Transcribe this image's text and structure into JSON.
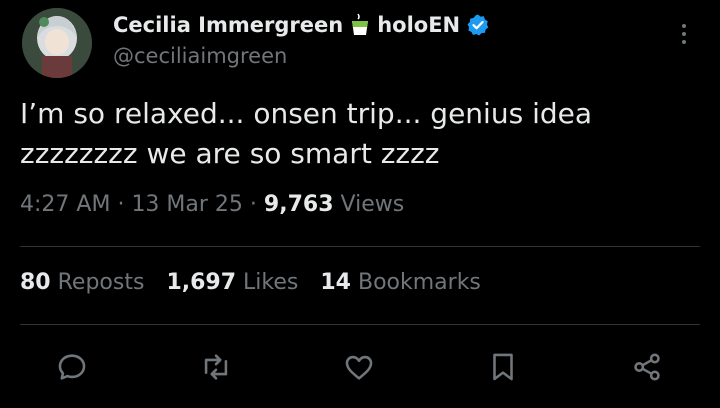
{
  "author": {
    "display_name": "Cecilia Immergreen",
    "affiliation": "holoEN",
    "handle": "@ceciliaimgreen",
    "emoji_icon": "tea-cup-icon",
    "verified_icon": "verified-badge-icon",
    "verified_color": "#1d9bf0"
  },
  "tweet": {
    "text": "I’m so relaxed... onsen trip... genius idea zzzzzzzz we are so smart zzzz",
    "time": "4:27 AM",
    "date": "13 Mar 25",
    "separator": "·",
    "views_count": "9,763",
    "views_label": "Views"
  },
  "stats": {
    "reposts_count": "80",
    "reposts_label": "Reposts",
    "likes_count": "1,697",
    "likes_label": "Likes",
    "bookmarks_count": "14",
    "bookmarks_label": "Bookmarks"
  },
  "actions": [
    "reply-icon",
    "repost-icon",
    "like-icon",
    "bookmark-icon",
    "share-icon"
  ],
  "colors": {
    "background": "#000000",
    "text": "#e7e9ea",
    "secondary_text": "#71767b",
    "divider": "#2f3336",
    "accent": "#1d9bf0"
  }
}
